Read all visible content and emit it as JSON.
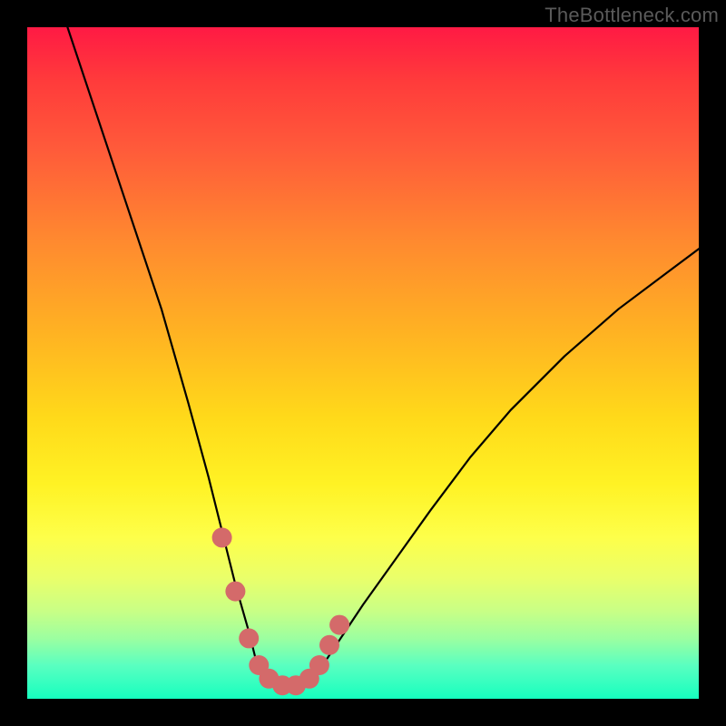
{
  "watermark": "TheBottleneck.com",
  "chart_data": {
    "type": "line",
    "title": "",
    "xlabel": "",
    "ylabel": "",
    "xlim": [
      0,
      100
    ],
    "ylim": [
      0,
      100
    ],
    "series": [
      {
        "name": "bottleneck-curve",
        "x": [
          6,
          10,
          15,
          20,
          24,
          27,
          29,
          31,
          33,
          34,
          36,
          38,
          40,
          42,
          44,
          46,
          50,
          55,
          60,
          66,
          72,
          80,
          88,
          96,
          100
        ],
        "y": [
          100,
          88,
          73,
          58,
          44,
          33,
          25,
          17,
          10,
          6,
          3,
          2,
          2,
          3,
          5,
          8,
          14,
          21,
          28,
          36,
          43,
          51,
          58,
          64,
          67
        ]
      }
    ],
    "highlight_points": {
      "name": "highlighted-segment",
      "color": "#d46a6a",
      "x": [
        29,
        31,
        33,
        34.5,
        36,
        38,
        40,
        42,
        43.5,
        45,
        46.5
      ],
      "y": [
        24,
        16,
        9,
        5,
        3,
        2,
        2,
        3,
        5,
        8,
        11
      ]
    },
    "gradient_stops": [
      {
        "pos": 0,
        "color": "#ff1a44"
      },
      {
        "pos": 18,
        "color": "#ff5a3a"
      },
      {
        "pos": 46,
        "color": "#ffb422"
      },
      {
        "pos": 68,
        "color": "#fff224"
      },
      {
        "pos": 87,
        "color": "#c8ff86"
      },
      {
        "pos": 100,
        "color": "#16ffbf"
      }
    ]
  }
}
